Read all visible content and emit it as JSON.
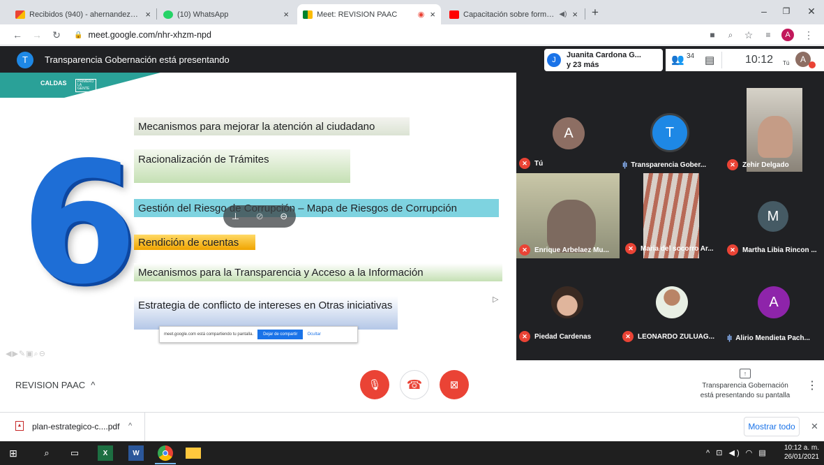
{
  "browser": {
    "tabs": [
      {
        "title": "Recibidos (940) - ahernandez@g",
        "favicon": "gmail-icon"
      },
      {
        "title": "(10) WhatsApp",
        "favicon": "whatsapp-icon"
      },
      {
        "title": "Meet: REVISION PAAC",
        "favicon": "meet-icon"
      },
      {
        "title": "Capacitación sobre formulac",
        "favicon": "youtube-icon"
      }
    ],
    "url": "meet.google.com/nhr-xhzm-npd",
    "profile_initial": "A"
  },
  "meet": {
    "presenter_initial": "T",
    "presenting_text": "Transparencia Gobernación está presentando",
    "speaker_initial": "J",
    "speaker_name": "Juanita Cardona G...",
    "speaker_more": "y 23 más",
    "participant_count": "34",
    "time": "10:12",
    "self_label": "Tú",
    "self_initial": "A",
    "meeting_name": "REVISION PAAC",
    "presenting_note_1": "Transparencia Gobernación",
    "presenting_note_2": "está presentando su pantalla"
  },
  "slide": {
    "logo_text": "CALDAS",
    "logo_badge": "PRIMERO LA GENTE",
    "big_number": "6",
    "items": [
      "Mecanismos para mejorar la atención al ciudadano",
      "Racionalización de Trámites",
      "Gestión del Riesgo de Corrupción – Mapa de Riesgos de Corrupción",
      "Rendición de cuentas",
      "Mecanismos para la Transparencia y Acceso a la Información",
      "Estrategia de conflicto de intereses en Otras iniciativas"
    ],
    "share_notice": "meet.google.com está compartiendo tu pantalla.",
    "stop_share": "Dejar de compartir",
    "hide": "Ocultar"
  },
  "participants": [
    {
      "name": "Tú",
      "initial": "A",
      "color": "#8d6e63",
      "muted": true
    },
    {
      "name": "Transparencia Gober...",
      "initial": "T",
      "color": "#1e88e5",
      "muted": false
    },
    {
      "name": "Zehir Delgado",
      "initial": "",
      "color": "",
      "muted": true
    },
    {
      "name": "Enrique Arbelaez Mu...",
      "initial": "",
      "color": "",
      "muted": true
    },
    {
      "name": "Maria del socorro Ar...",
      "initial": "",
      "color": "",
      "muted": true
    },
    {
      "name": "Martha Libia Rincon ...",
      "initial": "M",
      "color": "#455a64",
      "muted": true
    },
    {
      "name": "Piedad Cardenas",
      "initial": "",
      "color": "",
      "muted": true
    },
    {
      "name": "LEONARDO ZULUAG...",
      "initial": "",
      "color": "",
      "muted": true
    },
    {
      "name": "Alirio Mendieta Pach...",
      "initial": "A",
      "color": "#8e24aa",
      "muted": false
    }
  ],
  "downloads": {
    "file": "plan-estrategico-c....pdf",
    "show_all": "Mostrar todo"
  },
  "taskbar": {
    "time": "10:12 a. m.",
    "date": "26/01/2021"
  },
  "colors": {
    "danger": "#ea4335",
    "meet_bg": "#202124",
    "accent": "#1a73e8"
  }
}
